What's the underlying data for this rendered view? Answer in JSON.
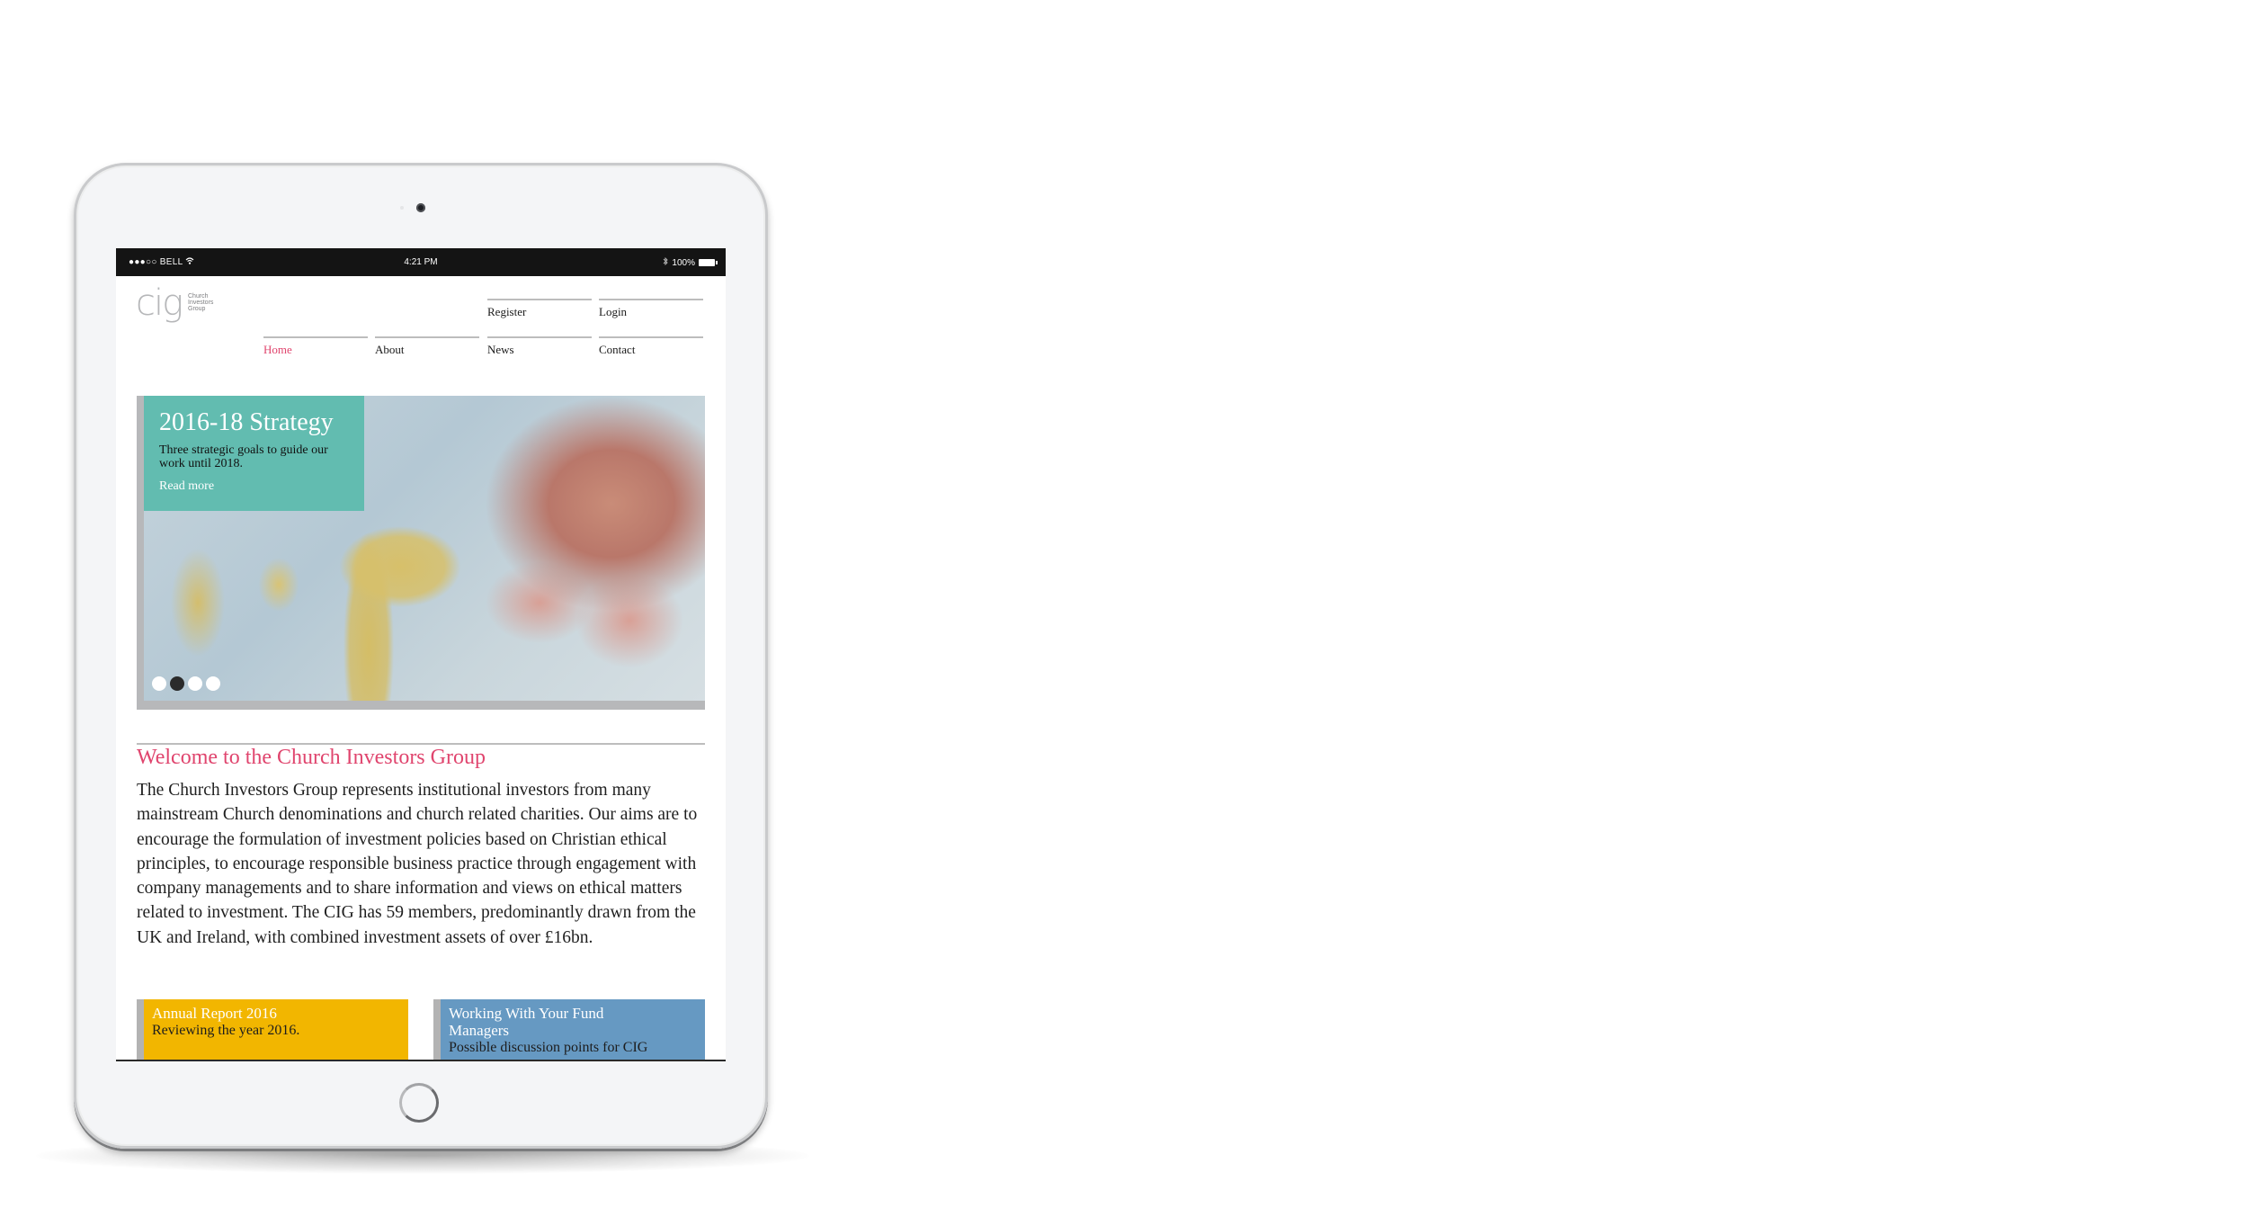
{
  "device": {
    "status_bar": {
      "carrier": "●●●○○ BELL",
      "wifi_icon": "wifi-icon",
      "time": "4:21 PM",
      "bluetooth_icon": "bluetooth-icon",
      "battery": "100%"
    }
  },
  "site": {
    "logo": {
      "mark": "cig",
      "line1": "Church",
      "line2": "Investors",
      "line3": "Group"
    },
    "nav_top": [
      {
        "label": "Register"
      },
      {
        "label": "Login"
      }
    ],
    "nav_main": [
      {
        "label": "Home",
        "active": true
      },
      {
        "label": "About",
        "active": false
      },
      {
        "label": "News",
        "active": false
      },
      {
        "label": "Contact",
        "active": false
      }
    ],
    "hero": {
      "title": "2016-18 Strategy",
      "description": "Three strategic goals to guide our work until 2018.",
      "link": "Read more",
      "slides_total": 4,
      "active_slide": 2
    },
    "welcome": {
      "heading": "Welcome to the Church Investors Group",
      "body": "The Church Investors Group represents institutional investors from many mainstream Church denominations and church related charities. Our aims are to encourage the formulation of investment policies based on Christian ethical principles, to encourage responsible business practice through engagement with company managements and to share information and views on ethical matters related to investment. The CIG has 59 members, predominantly drawn from the UK and Ireland, with combined investment assets of over £16bn."
    },
    "cards": [
      {
        "title": "Annual Report 2016",
        "subtitle": "Reviewing the year 2016."
      },
      {
        "title": "Working With Your Fund Managers",
        "subtitle": "Possible discussion points for CIG"
      }
    ]
  },
  "colors": {
    "accent_pink": "#e0456e",
    "hero_teal": "#62bcb0",
    "card_yellow": "#f2b600",
    "card_blue": "#6699c2"
  }
}
